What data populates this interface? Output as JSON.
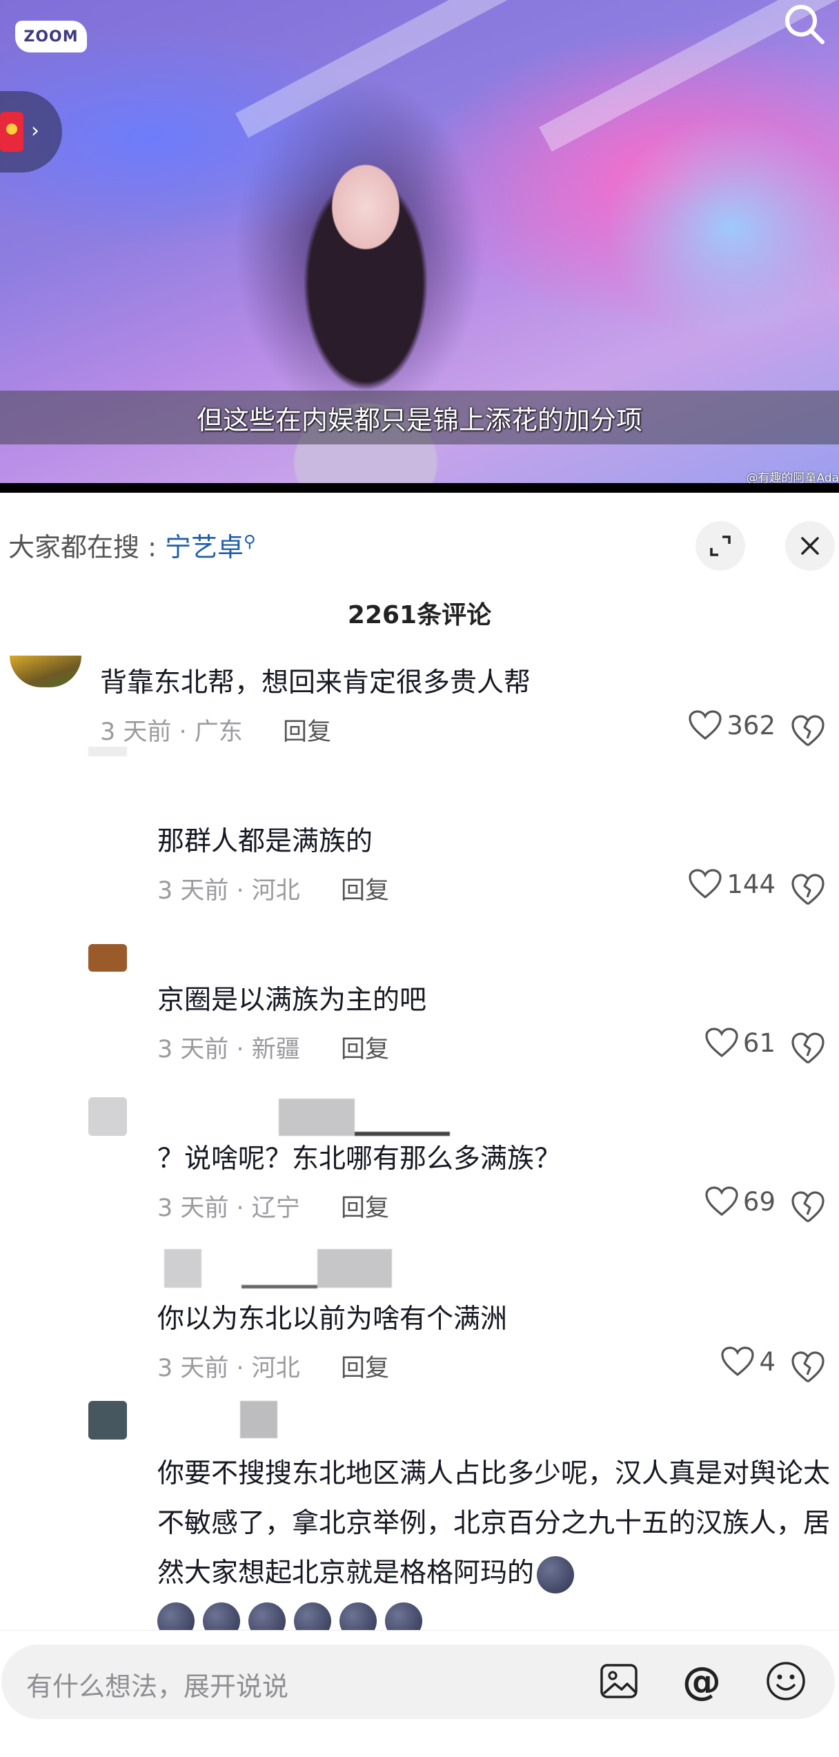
{
  "video": {
    "logo": "ZOOM",
    "subtitle": "但这些在内娱都只是锦上添花的加分项",
    "watermark": "@有趣的阿童Ada"
  },
  "search_bar": {
    "prefix": "大家都在搜 :",
    "keyword": "宁艺卓"
  },
  "comments_header": {
    "count_label": "2261条评论"
  },
  "comments": [
    {
      "text": "背靠东北帮，想回来肯定很多贵人帮",
      "time": "3 天前",
      "location": "广东",
      "reply": "回复",
      "likes": "362"
    },
    {
      "text": "那群人都是满族的",
      "time": "3 天前",
      "location": "河北",
      "reply": "回复",
      "likes": "144"
    },
    {
      "text": "京圈是以满族为主的吧",
      "time": "3 天前",
      "location": "新疆",
      "reply": "回复",
      "likes": "61"
    },
    {
      "text": "？说啥呢？东北哪有那么多满族？",
      "time": "3 天前",
      "location": "辽宁",
      "reply": "回复",
      "likes": "69"
    },
    {
      "text": "你以为东北以前为啥有个满洲",
      "time": "3 天前",
      "location": "河北",
      "reply": "回复",
      "likes": "4"
    },
    {
      "text": "你要不搜搜东北地区满人占比多少呢，汉人真是对舆论太不敏感了，拿北京举例，北京百分之九十五的汉族人，居然大家想起北京就是格格阿玛的"
    }
  ],
  "input": {
    "placeholder": "有什么想法，展开说说"
  },
  "colors": {
    "link": "#1f5fa8",
    "meta": "#9a9a9f",
    "input_bg": "#f1f1f2"
  },
  "icons": [
    "search-icon",
    "red-packet-icon",
    "expand-icon",
    "close-icon",
    "heart-icon",
    "broken-heart-icon",
    "image-icon",
    "at-icon",
    "emoji-icon"
  ]
}
